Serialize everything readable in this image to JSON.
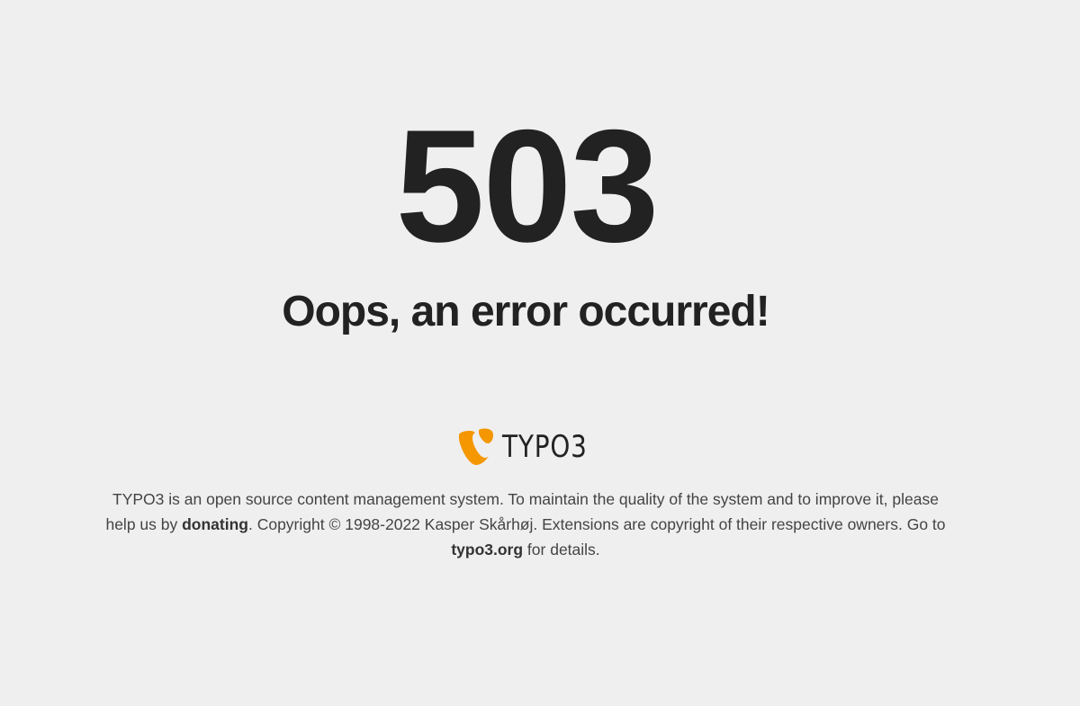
{
  "error": {
    "code": "503",
    "message": "Oops, an error occurred!"
  },
  "logo": {
    "text": "TYPO3",
    "icon": "typo3-logo-icon",
    "brand_color": "#f49700"
  },
  "footer": {
    "text_1": "TYPO3 is an open source content management system. To maintain the quality of the system and to improve it, please help us by ",
    "donate_link": "donating",
    "text_2": ". Copyright © 1998-2022 Kasper Skårhøj. Extensions are copyright of their respective owners. Go to ",
    "site_link": "typo3.org",
    "text_3": " for details."
  }
}
